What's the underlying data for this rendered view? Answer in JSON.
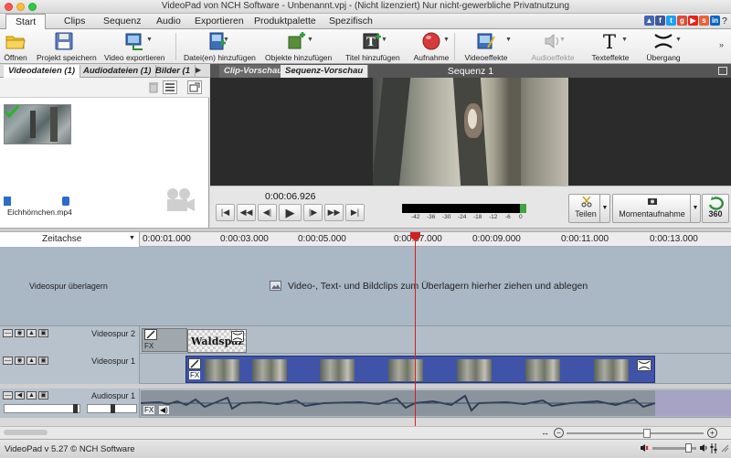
{
  "window": {
    "title": "VideoPad von NCH Software - Unbenannt.vpj - (Nicht lizenziert) Nur nicht-gewerbliche Privatnutzung"
  },
  "menu": {
    "items": [
      "Start",
      "Clips",
      "Sequenz",
      "Audio",
      "Exportieren",
      "Produktpalette",
      "Spezifisch"
    ],
    "active": "Start",
    "help": "?"
  },
  "toolbar": {
    "buttons": [
      {
        "label": "Öffnen",
        "icon": "folder-icon"
      },
      {
        "label": "Projekt speichern",
        "icon": "floppy-icon"
      },
      {
        "label": "Video exportieren",
        "icon": "export-video-icon"
      },
      {
        "label": "Datei(en) hinzufügen",
        "icon": "add-file-icon"
      },
      {
        "label": "Objekte hinzufügen",
        "icon": "add-objects-icon"
      },
      {
        "label": "Titel hinzufügen",
        "icon": "add-title-icon"
      },
      {
        "label": "Aufnahme",
        "icon": "record-icon"
      },
      {
        "label": "Videoeffekte",
        "icon": "video-effects-icon"
      },
      {
        "label": "Audioeffekte",
        "icon": "audio-effects-icon"
      },
      {
        "label": "Texteffekte",
        "icon": "text-effects-icon"
      },
      {
        "label": "Übergang",
        "icon": "transition-icon"
      }
    ]
  },
  "bin": {
    "tabs": [
      "Videodateien (1)",
      "Audiodateien (1)",
      "Bilder (1"
    ],
    "active_tab": "Videodateien (1)",
    "clip_name": "Eichhörnchen.mp4"
  },
  "preview": {
    "tabs": [
      "Clip-Vorschau",
      "Sequenz-Vorschau"
    ],
    "active_tab": "Sequenz-Vorschau",
    "sequence_title": "Sequenz 1",
    "timecode": "0:00:06.926",
    "meter_scale": [
      "-42",
      "-36",
      "-30",
      "-24",
      "-18",
      "-12",
      "-6",
      "0"
    ],
    "split_label": "Teilen",
    "snapshot_label": "Momentaufnahme",
    "vr360_label": "360"
  },
  "timeline": {
    "label": "Zeitachse",
    "ticks": [
      "0:00:01.000",
      "0:00:03.000",
      "0:00:05.000",
      "0:00:07.000",
      "0:00:09.000",
      "0:00:11.000",
      "0:00:13.000"
    ],
    "overlay_track": "Videospur überlagern",
    "overlay_hint": "Video-, Text- und Bildclips zum Überlagern hierher ziehen und ablegen",
    "video_track_2": "Videospur 2",
    "video_track_1": "Videospur 1",
    "audio_track_1": "Audiospur 1",
    "text_clip": "Waldspaz",
    "fx": "FX"
  },
  "status": {
    "text": "VideoPad v 5.27 © NCH Software"
  },
  "colors": {
    "playhead": "#d42020",
    "video_clip": "#3f54a8",
    "record": "#d73a3a"
  }
}
